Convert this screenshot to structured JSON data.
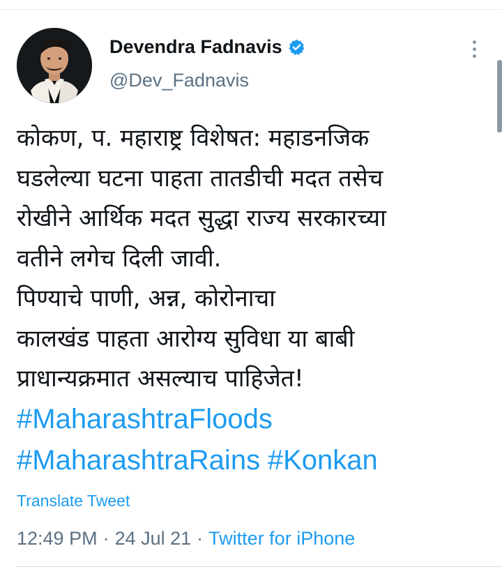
{
  "author": {
    "display_name": "Devendra Fadnavis",
    "handle": "@Dev_Fadnavis",
    "verified": true,
    "avatar_icon": "profile-photo",
    "verified_icon": "verified-badge-icon"
  },
  "more_icon": "more-vertical-icon",
  "tweet": {
    "lines": [
      "कोकण, प. महाराष्ट्र विशेषत: महाडनजिक",
      "घडलेल्या घटना पाहता तातडीची मदत तसेच",
      "रोखीने आर्थिक मदत सुद्धा राज्य सरकारच्या",
      "वतीने लगेच दिली जावी.",
      "पिण्याचे पाणी, अन्न, कोरोनाचा",
      "कालखंड पाहता आरोग्य सुविधा या बाबी",
      "प्राधान्यक्रमात असल्याच पाहिजेत!"
    ],
    "hashtags": [
      "#MaharashtraFloods",
      "#MaharashtraRains",
      "#Konkan"
    ]
  },
  "translate_label": "Translate Tweet",
  "meta": {
    "time": "12:49 PM",
    "separator": "·",
    "date": "24 Jul 21",
    "source": "Twitter for iPhone"
  },
  "colors": {
    "link": "#1d9bf0",
    "secondary_text": "#5b7083",
    "primary_text": "#0f1419"
  }
}
